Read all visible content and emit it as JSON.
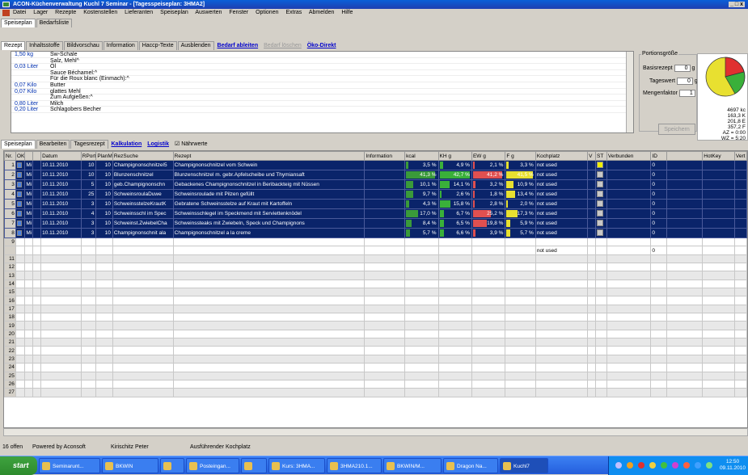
{
  "window": {
    "title": "ACON-Küchenverwaltung  Kuchl 7  Seminar - [Tagesspeiseplan: 3HMA2]",
    "controls": "_ □ x"
  },
  "menu": [
    "Datei",
    "Lager",
    "Rezepte",
    "Kostenstellen",
    "Lieferanten",
    "Speiseplan",
    "Auswerten",
    "Fenster",
    "Optionen",
    "Extras",
    "Abmelden",
    "Hilfe"
  ],
  "top_tabs": [
    "Speiseplan",
    "Bedarfsliste"
  ],
  "recipe_tabs": {
    "items": [
      "Rezept",
      "Inhaltsstoffe",
      "Bildvorschau",
      "Information",
      "Haccp-Texte",
      "Ausblenden"
    ],
    "link1": "Bedarf ableiten",
    "link2_disabled": "Bedarf löschen",
    "link3": "Öko-Direkt"
  },
  "recipe_lines": [
    {
      "q": "1,50 kg",
      "t": "Sw-Schale"
    },
    {
      "q": "",
      "t": "Salz, Mehl^"
    },
    {
      "q": "0,03 Liter",
      "t": "Öl"
    },
    {
      "q": "",
      "t": "Sauce Béchamel:^"
    },
    {
      "q": "",
      "t": "Für die Roux blanc (Einmach):^"
    },
    {
      "q": "0,07 Kilo",
      "t": "Butter"
    },
    {
      "q": "0,07 Kilo",
      "t": "glattes Mehl"
    },
    {
      "q": "",
      "t": "Zum Aufgießen:^"
    },
    {
      "q": "0,80 Liter",
      "t": "Milch"
    },
    {
      "q": "0,20 Liter",
      "t": "Schlagobers Becher"
    }
  ],
  "portion": {
    "title": "Portionsgröße",
    "basis_label": "Basisrezept",
    "basis_value": "0",
    "basis_unit": "g",
    "tages_label": "Tageswert",
    "tages_value": "0",
    "tages_unit": "g",
    "mengen_label": "Mengenfaktor",
    "mengen_value": "1",
    "save": "Speichern"
  },
  "nutrition_info": [
    "4697  kc",
    "163,3 K",
    "201,8 E",
    "357,2 F",
    "AZ = 0:00",
    "WZ = 5:20"
  ],
  "bottom_tabs": {
    "items": [
      "Speiseplan",
      "Bearbeiten",
      "Tagesrezept"
    ],
    "link1": "Kalkulation",
    "link2": "Logistik",
    "check_label": "Nährwerte"
  },
  "columns": [
    "Nr.",
    "OK",
    "",
    "",
    "Datum",
    "RPort",
    "PlanM",
    "RezSuche",
    "Rezept",
    "Information",
    "kcal",
    "KH g",
    "EW g",
    "F g",
    "Kochplatz",
    "V",
    "ST",
    "Verbunden",
    "ID",
    "",
    "HotKey",
    "Vert"
  ],
  "rows": [
    {
      "nr": "1",
      "day": "Mi",
      "date": "10.11.2010",
      "rport": "10",
      "planm": "10",
      "suche": "Champignonschnitzel5",
      "rezept": "Champignonschnitzel vom Schwein",
      "kcal": "3,5 %",
      "kcal_v": 3.5,
      "kh": "4,9 %",
      "kh_v": 4.9,
      "ew": "2,1 %",
      "ew_v": 2.1,
      "f": "3,3 %",
      "f_v": 3.3,
      "koch": "not used",
      "st": "yellow",
      "id": "0"
    },
    {
      "nr": "2",
      "day": "Mi",
      "date": "10.11.2010",
      "rport": "10",
      "planm": "10",
      "suche": "Blunzenschnitzel",
      "rezept": "Blunzenschnitzel m. gebr.Apfelscheibe und Thymiansaft",
      "kcal": "41,3 %",
      "kcal_v": 41.3,
      "kh": "42,7 %",
      "kh_v": 42.7,
      "ew": "41,2 %",
      "ew_v": 41.2,
      "f": "41,5 %",
      "f_v": 41.5,
      "koch": "not used",
      "st": "gray",
      "id": "0"
    },
    {
      "nr": "3",
      "day": "Mi",
      "date": "10.11.2010",
      "rport": "5",
      "planm": "10",
      "suche": "geb.Champignonschn",
      "rezept": "Gebackenes Champignonschnitzel in Beribackteig mit Nüssen",
      "kcal": "10,1 %",
      "kcal_v": 10.1,
      "kh": "14,1 %",
      "kh_v": 14.1,
      "ew": "3,2 %",
      "ew_v": 3.2,
      "f": "10,9 %",
      "f_v": 10.9,
      "koch": "not used",
      "st": "gray",
      "id": "0"
    },
    {
      "nr": "4",
      "day": "Mi",
      "date": "10.11.2010",
      "rport": "25",
      "planm": "10",
      "suche": "SchweinsroulaDuwe",
      "rezept": "Schweinsroulade mit Pilzen gefüllt",
      "kcal": "9,7 %",
      "kcal_v": 9.7,
      "kh": "2,6 %",
      "kh_v": 2.6,
      "ew": "1,8 %",
      "ew_v": 1.8,
      "f": "13,4 %",
      "f_v": 13.4,
      "koch": "not used",
      "st": "gray",
      "id": "0"
    },
    {
      "nr": "5",
      "day": "Mi",
      "date": "10.11.2010",
      "rport": "3",
      "planm": "10",
      "suche": "SchweinsstelzeKrautK",
      "rezept": "Gebratene Schweinsstelze auf Kraut mit Kartoffeln",
      "kcal": "4,3 %",
      "kcal_v": 4.3,
      "kh": "15,8 %",
      "kh_v": 15.8,
      "ew": "2,8 %",
      "ew_v": 2.8,
      "f": "2,0 %",
      "f_v": 2.0,
      "koch": "not used",
      "st": "gray",
      "id": "0"
    },
    {
      "nr": "6",
      "day": "Mi",
      "date": "10.11.2010",
      "rport": "4",
      "planm": "10",
      "suche": "Schweinsschl im Spec",
      "rezept": "Schweinsschlegel im Speckmend mit Serviettenknödel",
      "kcal": "17,0 %",
      "kcal_v": 17.0,
      "kh": "6,7 %",
      "kh_v": 6.7,
      "ew": "25,2 %",
      "ew_v": 25.2,
      "f": "17,3 %",
      "f_v": 17.3,
      "koch": "not used",
      "st": "gray",
      "id": "0"
    },
    {
      "nr": "7",
      "day": "Mi",
      "date": "10.11.2010",
      "rport": "3",
      "planm": "10",
      "suche": "Schweinst.ZwiebelCha",
      "rezept": "Schweinssteaks mit Zwiebeln, Speck und Champignons",
      "kcal": "8,4 %",
      "kcal_v": 8.4,
      "kh": "6,5 %",
      "kh_v": 6.5,
      "ew": "19,8 %",
      "ew_v": 19.8,
      "f": "5,9 %",
      "f_v": 5.9,
      "koch": "not used",
      "st": "gray",
      "id": "0"
    },
    {
      "nr": "8",
      "day": "Mi",
      "date": "10.11.2010",
      "rport": "3",
      "planm": "10",
      "suche": "Champignonschnit ala",
      "rezept": "Champignonschnitzel a la creme",
      "kcal": "5,7 %",
      "kcal_v": 5.7,
      "kh": "6,6 %",
      "kh_v": 6.6,
      "ew": "3,9 %",
      "ew_v": 3.9,
      "f": "5,7 %",
      "f_v": 5.7,
      "koch": "not used",
      "st": "gray",
      "id": "0"
    }
  ],
  "empty_row": {
    "nr": "9",
    "koch": "not used",
    "id": "0"
  },
  "empty_row_numbers": [
    "11",
    "12",
    "13",
    "14",
    "15",
    "16",
    "17",
    "18",
    "19",
    "20",
    "21",
    "22",
    "23",
    "24",
    "25",
    "26",
    "27"
  ],
  "bar_colors": {
    "kcal": "#3a9a3a",
    "kh": "#3ab03a",
    "ew": "#e05050",
    "f": "#e8e030"
  },
  "status": {
    "count": "16 offen",
    "powered": "Powered by Aconsoft",
    "user": "Kirischitz Peter",
    "place": "Ausführender Kochplatz"
  },
  "taskbar": {
    "start": "start",
    "tasks": [
      "Seminarunt...",
      "BKWIN",
      "",
      "Posteingan...",
      "",
      "Kurs: 3HMA...",
      "3HMA210.1...",
      "BKWIN/M...",
      "Dragon Na...",
      "Kuchl7"
    ],
    "time": "12:50",
    "date": "09.11.2010"
  }
}
